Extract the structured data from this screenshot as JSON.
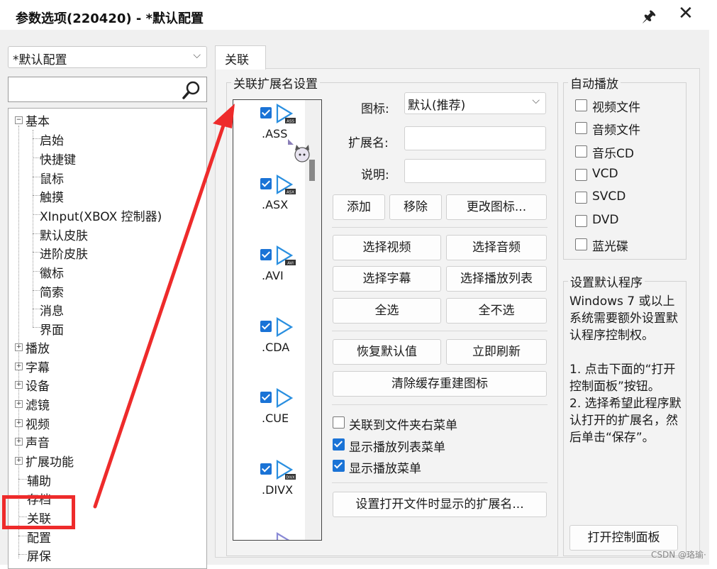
{
  "window": {
    "title": "参数选项(220420) - *默认配置",
    "pin_glyph": "🖈",
    "close_glyph": "✕"
  },
  "profile_combo": {
    "value": "*默认配置"
  },
  "tree": {
    "basic": "基本",
    "basic_children": [
      "启始",
      "快捷键",
      "鼠标",
      "触摸",
      "XInput(XBOX 控制器)",
      "默认皮肤",
      "进阶皮肤",
      "徽标",
      "简索",
      "消息",
      "界面"
    ],
    "collapsed": [
      "播放",
      "字幕",
      "设备",
      "滤镜",
      "视频",
      "声音",
      "扩展功能"
    ],
    "tail": [
      "辅助",
      "存档",
      "关联",
      "配置",
      "屏保"
    ]
  },
  "tab": {
    "label": "关联"
  },
  "assoc_group": {
    "label": "关联扩展名设置"
  },
  "extensions": [
    {
      "name": ".ASS",
      "badge": "ASS"
    },
    {
      "name": ".ASX",
      "badge": "ASX"
    },
    {
      "name": ".AVI",
      "badge": "AVI"
    },
    {
      "name": ".CDA",
      "badge": ""
    },
    {
      "name": ".CUE",
      "badge": ""
    },
    {
      "name": ".DIVX",
      "badge": "DIVX"
    }
  ],
  "form": {
    "icon_label": "图标:",
    "icon_value": "默认(推荐)",
    "ext_label": "扩展名:",
    "ext_value": "",
    "desc_label": "说明:",
    "desc_value": ""
  },
  "buttons": {
    "add": "添加",
    "remove": "移除",
    "change_icon": "更改图标...",
    "select_video": "选择视频",
    "select_audio": "选择音频",
    "select_subtitle": "选择字幕",
    "select_playlist": "选择播放列表",
    "select_all": "全选",
    "select_none": "全不选",
    "restore_default": "恢复默认值",
    "refresh_now": "立即刷新",
    "clear_cache": "清除缓存重建图标",
    "set_open_ext": "设置打开文件时显示的扩展名...",
    "open_control_panel": "打开控制面板"
  },
  "options": [
    {
      "label": "关联到文件夹右菜单",
      "checked": false
    },
    {
      "label": "显示播放列表菜单",
      "checked": true
    },
    {
      "label": "显示播放菜单",
      "checked": true
    }
  ],
  "autoplay": {
    "label": "自动播放",
    "items": [
      "视频文件",
      "音频文件",
      "音乐CD",
      "VCD",
      "SVCD",
      "DVD",
      "蓝光碟"
    ]
  },
  "default_program": {
    "label": "设置默认程序",
    "text1": "Windows 7 或以上系统需要额外设置默认程序控制权。",
    "text2": "1. 点击下面的“打开控制面板”按钮。",
    "text3": "2. 选择希望此程序默认打开的扩展名，然后单击“保存”。"
  },
  "watermark": "CSDN @珞瑜·",
  "colors": {
    "annotation": "#ee2b2b",
    "check": "#1a73d6"
  }
}
